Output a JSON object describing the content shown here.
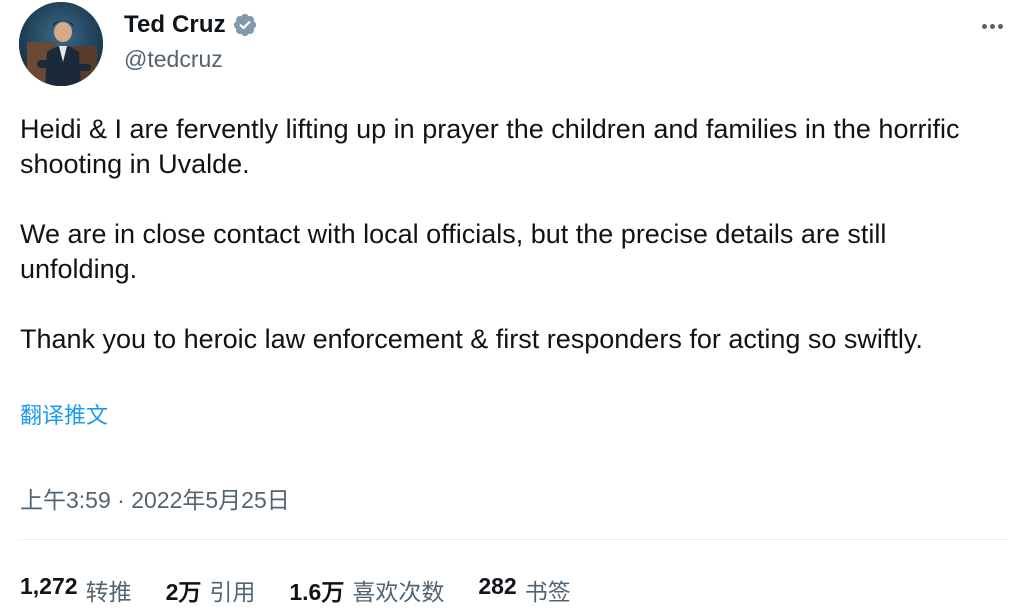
{
  "author": {
    "display_name": "Ted Cruz",
    "handle": "@tedcruz",
    "verified": true,
    "verified_color": "#829aab"
  },
  "tweet": {
    "paragraphs": [
      "Heidi & I are fervently lifting up in prayer the children and families in the horrific shooting in Uvalde.",
      "We are in close contact with local officials, but the precise details are still unfolding.",
      "Thank you to heroic law enforcement & first responders for acting so swiftly."
    ],
    "translate_link": "翻译推文",
    "timestamp": "上午3:59 · 2022年5月25日"
  },
  "stats": [
    {
      "value": "1,272",
      "label": "转推"
    },
    {
      "value": "2万",
      "label": "引用"
    },
    {
      "value": "1.6万",
      "label": "喜欢次数"
    },
    {
      "value": "282",
      "label": "书签"
    }
  ],
  "colors": {
    "text": "#0f1419",
    "secondary": "#536471",
    "link": "#1d9bf0",
    "divider": "#eff3f4"
  },
  "icons": {
    "more": "more-horizontal-icon",
    "verified": "verified-badge-icon"
  }
}
